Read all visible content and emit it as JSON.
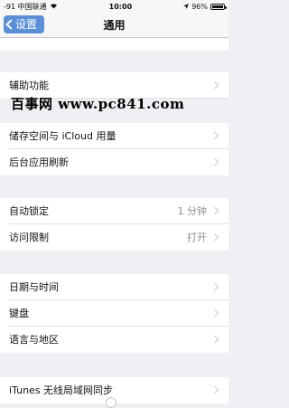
{
  "status_bar": {
    "carrier": "-91 中国联通",
    "time": "10:00",
    "battery": "96%",
    "battery_level": 0.96
  },
  "nav": {
    "back_label": "设置",
    "title": "通用"
  },
  "rows": [
    {
      "label": "辅助功能",
      "value": ""
    },
    {
      "label": "储存空间与 iCloud 用量",
      "value": ""
    },
    {
      "label": "后台应用刷新",
      "value": ""
    },
    {
      "label": "自动锁定",
      "value": "1 分钟"
    },
    {
      "label": "访问限制",
      "value": "打开"
    },
    {
      "label": "日期与时间",
      "value": ""
    },
    {
      "label": "键盘",
      "value": ""
    },
    {
      "label": "语言与地区",
      "value": ""
    },
    {
      "label": "iTunes 无线局域网同步",
      "value": ""
    }
  ],
  "watermark": "百事网 www.pc841.com",
  "icons": {
    "back": "chevron-left-icon",
    "disclosure": "chevron-right-icon",
    "wifi": "wifi-icon",
    "battery": "battery-icon",
    "location": "location-arrow-icon"
  }
}
